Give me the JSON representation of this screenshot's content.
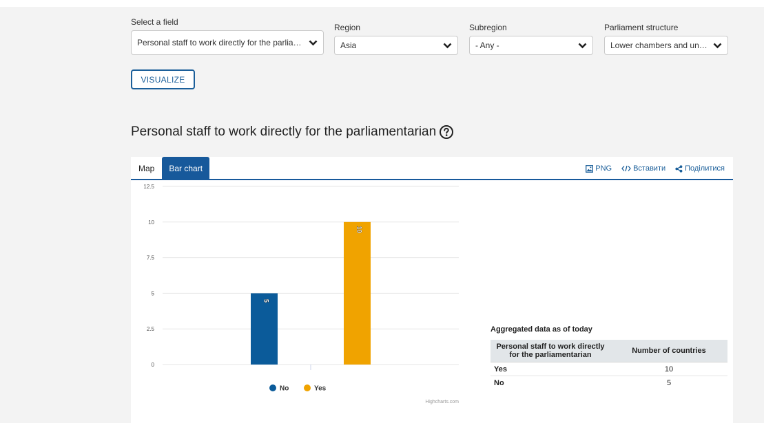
{
  "filters": {
    "field": {
      "label": "Select a field",
      "value": "Personal staff to work directly for the parliam..."
    },
    "region": {
      "label": "Region",
      "value": "Asia"
    },
    "subregion": {
      "label": "Subregion",
      "value": "- Any -"
    },
    "structure": {
      "label": "Parliament structure",
      "value": "Lower chambers and unic..."
    }
  },
  "visualize_label": "VISUALIZE",
  "title": "Personal staff to work directly for the parliamentarian",
  "tabs": [
    {
      "label": "Map"
    },
    {
      "label": "Bar chart"
    }
  ],
  "actions": {
    "png": "PNG",
    "embed": "Вставити",
    "share": "Поділитися"
  },
  "colors": {
    "primary": "#17599b",
    "no": "#0b5b9a",
    "yes": "#f0a300"
  },
  "chart_data": {
    "type": "bar",
    "series": [
      {
        "name": "No",
        "value": 5,
        "color": "#0b5b9a"
      },
      {
        "name": "Yes",
        "value": 10,
        "color": "#f0a300"
      }
    ],
    "ylim": [
      0,
      12.5
    ],
    "yticks": [
      "0",
      "2.5",
      "5",
      "7.5",
      "10",
      "12.5"
    ],
    "legend_position": "bottom-center",
    "grid": true,
    "credit": "Highcharts.com"
  },
  "aggregated": {
    "title": "Aggregated data as of today",
    "headers": [
      "Personal staff to work directly for the parliamentarian",
      "Number of countries"
    ],
    "rows": [
      {
        "key": "Yes",
        "value": "10"
      },
      {
        "key": "No",
        "value": "5"
      }
    ]
  }
}
